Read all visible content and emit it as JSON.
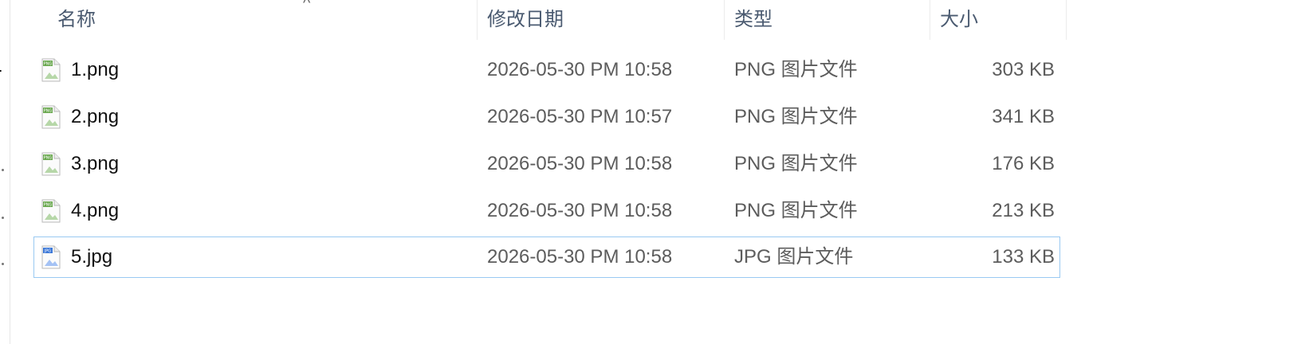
{
  "columns": {
    "name": "名称",
    "date": "修改日期",
    "type": "类型",
    "size": "大小"
  },
  "files": [
    {
      "name": "1.png",
      "date": "2026-05-30 PM 10:58",
      "type": "PNG 图片文件",
      "size": "303 KB",
      "icon": "png-file-icon",
      "icon_color": "#6aa84f"
    },
    {
      "name": "2.png",
      "date": "2026-05-30 PM 10:57",
      "type": "PNG 图片文件",
      "size": "341 KB",
      "icon": "png-file-icon",
      "icon_color": "#6aa84f"
    },
    {
      "name": "3.png",
      "date": "2026-05-30 PM 10:58",
      "type": "PNG 图片文件",
      "size": "176 KB",
      "icon": "png-file-icon",
      "icon_color": "#6aa84f"
    },
    {
      "name": "4.png",
      "date": "2026-05-30 PM 10:58",
      "type": "PNG 图片文件",
      "size": "213 KB",
      "icon": "png-file-icon",
      "icon_color": "#6aa84f"
    },
    {
      "name": "5.jpg",
      "date": "2026-05-30 PM 10:58",
      "type": "JPG 图片文件",
      "size": "133 KB",
      "icon": "jpg-file-icon",
      "icon_color": "#3c78d8",
      "selected": true
    }
  ],
  "nav": {
    "partial_char": "r"
  },
  "colors": {
    "selection_border": "#99c9f2",
    "header_text": "#4a5a70"
  }
}
